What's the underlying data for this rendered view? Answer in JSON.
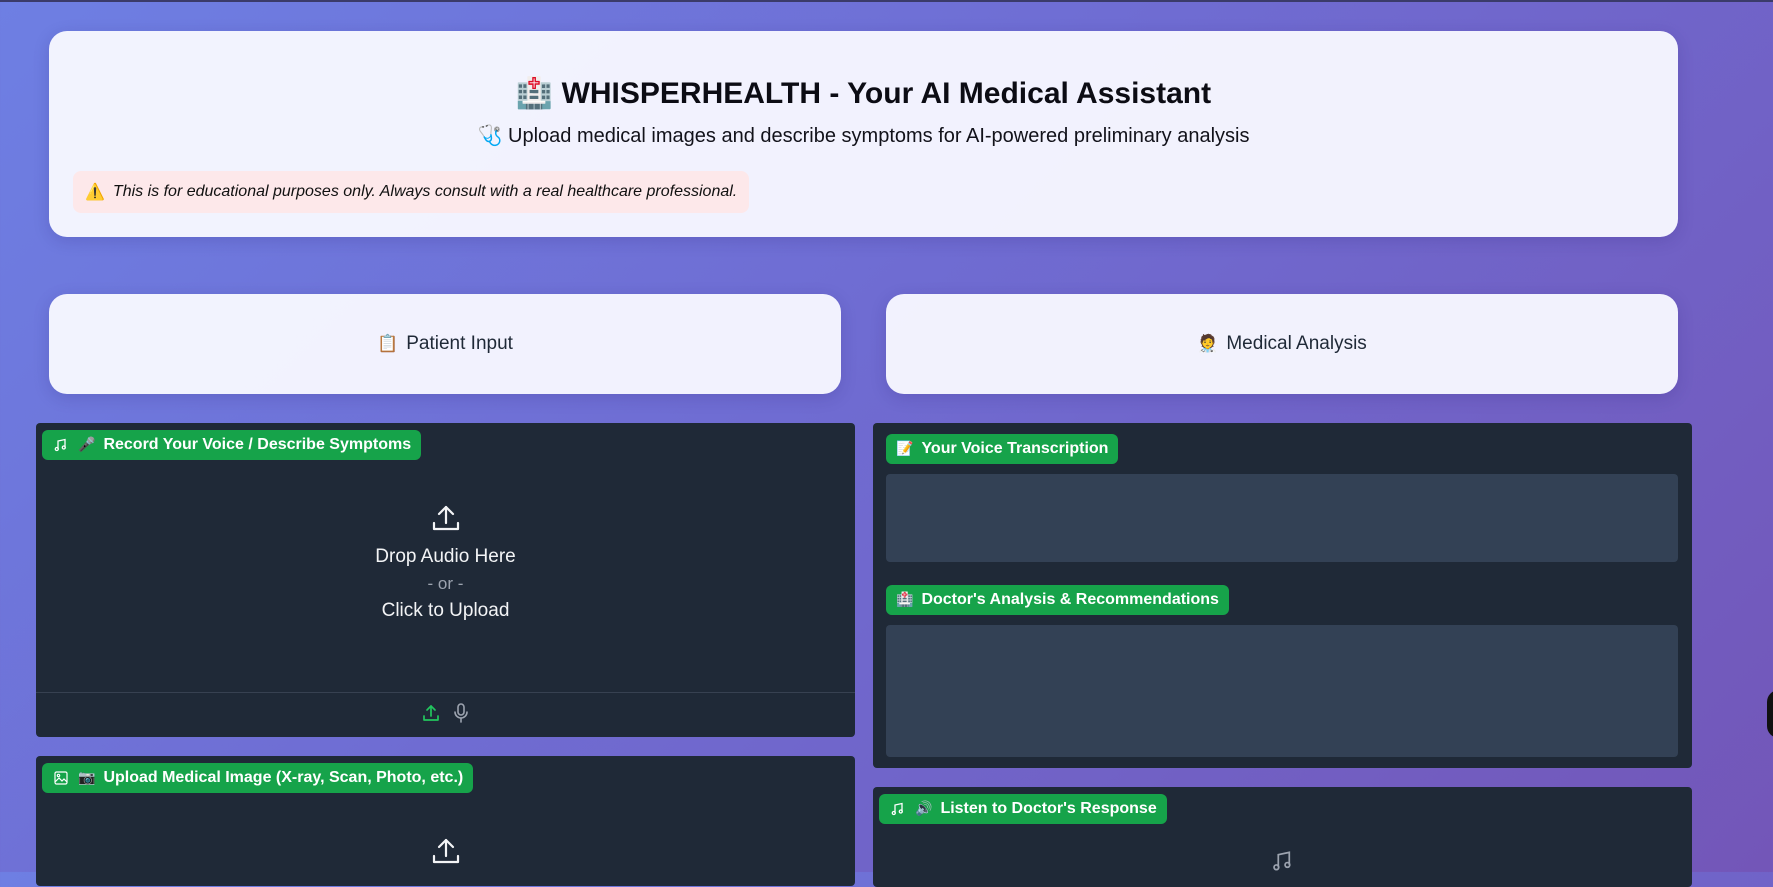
{
  "header": {
    "title_emoji": "🏥",
    "title": "WHISPERHEALTH - Your AI Medical Assistant",
    "subtitle_emoji": "🩺",
    "subtitle": "Upload medical images and describe symptoms for AI-powered preliminary analysis",
    "warning_emoji": "⚠️",
    "warning": "This is for educational purposes only. Always consult with a real healthcare professional."
  },
  "sections": {
    "patient_input": {
      "emoji": "📋",
      "label": "Patient Input"
    },
    "medical_analysis": {
      "emoji": "🧑‍⚕️",
      "label": "Medical Analysis"
    }
  },
  "audio_input": {
    "badge_emoji": "🎤",
    "badge": "Record Your Voice / Describe Symptoms",
    "drop_text": "Drop Audio Here",
    "or_text": "- or -",
    "click_text": "Click to Upload"
  },
  "image_input": {
    "badge_emoji": "📷",
    "badge": "Upload Medical Image (X-ray, Scan, Photo, etc.)"
  },
  "transcription": {
    "badge_emoji": "📝",
    "badge": "Your Voice Transcription",
    "value": ""
  },
  "analysis": {
    "badge_emoji": "🏥",
    "badge": "Doctor's Analysis & Recommendations",
    "value": ""
  },
  "audio_output": {
    "badge_emoji": "🔊",
    "badge": "Listen to Doctor's Response"
  },
  "colors": {
    "accent_green": "#16a34a",
    "panel_dark": "#1f2937",
    "textbox": "#334155",
    "warning_bg": "#fde8ea"
  },
  "icons": {
    "audio_badge": "music-note-icon",
    "image_badge": "image-icon",
    "upload": "upload-icon",
    "microphone": "microphone-icon",
    "audio_output_badge": "music-note-icon"
  }
}
